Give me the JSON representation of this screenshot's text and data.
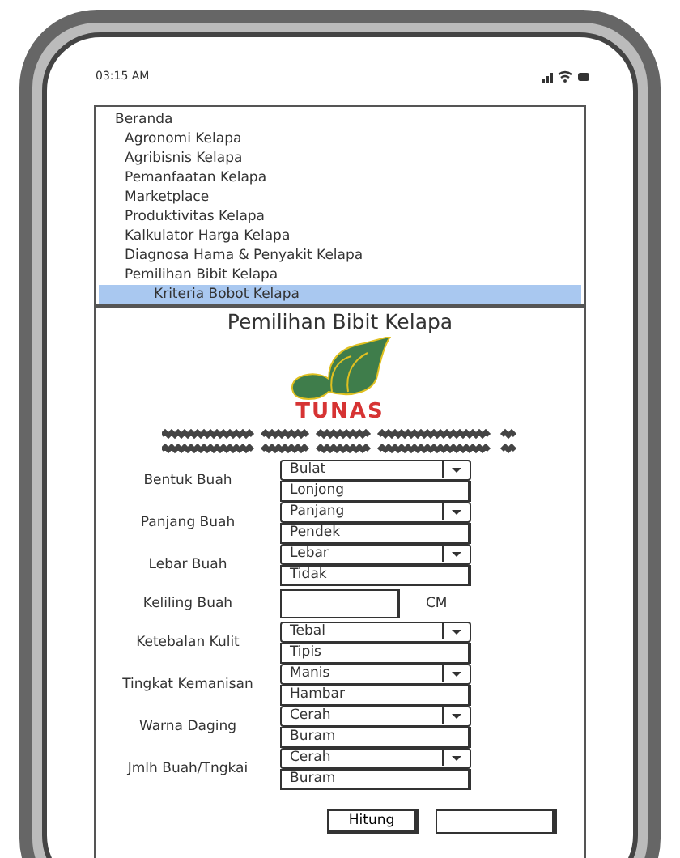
{
  "status_bar": {
    "time": "03:15 AM"
  },
  "menu": [
    {
      "label": "Beranda",
      "selected": false,
      "children": [
        {
          "label": "Agronomi Kelapa",
          "selected": false
        },
        {
          "label": "Agribisnis Kelapa",
          "selected": false
        },
        {
          "label": "Pemanfaatan Kelapa",
          "selected": false
        },
        {
          "label": "Marketplace",
          "selected": false
        },
        {
          "label": "Produktivitas Kelapa",
          "selected": false
        },
        {
          "label": "Kalkulator Harga Kelapa",
          "selected": false
        },
        {
          "label": "Diagnosa Hama & Penyakit Kelapa",
          "selected": false
        },
        {
          "label": "Pemilihan Bibit Kelapa",
          "selected": false,
          "children": [
            {
              "label": "Kriteria Bobot Kelapa",
              "selected": true
            }
          ]
        }
      ]
    }
  ],
  "title": "Pemilihan Bibit Kelapa",
  "logo_text": "TUNAS",
  "fields": [
    {
      "kind": "select",
      "label": "Bentuk Buah",
      "value": "Bulat",
      "option": "Lonjong"
    },
    {
      "kind": "select",
      "label": "Panjang Buah",
      "value": "Panjang",
      "option": "Pendek"
    },
    {
      "kind": "select",
      "label": "Lebar Buah",
      "value": "Lebar",
      "option": "Tidak"
    },
    {
      "kind": "input",
      "label": "Keliling Buah",
      "unit": "CM"
    },
    {
      "kind": "select",
      "label": "Ketebalan Kulit",
      "value": "Tebal",
      "option": "Tipis"
    },
    {
      "kind": "select",
      "label": "Tingkat Kemanisan",
      "value": "Manis",
      "option": "Hambar"
    },
    {
      "kind": "select",
      "label": "Warna Daging",
      "value": "Cerah",
      "option": "Buram"
    },
    {
      "kind": "select",
      "label": "Jmlh Buah/Tngkai",
      "value": "Cerah",
      "option": "Buram"
    }
  ],
  "button": "Hitung"
}
